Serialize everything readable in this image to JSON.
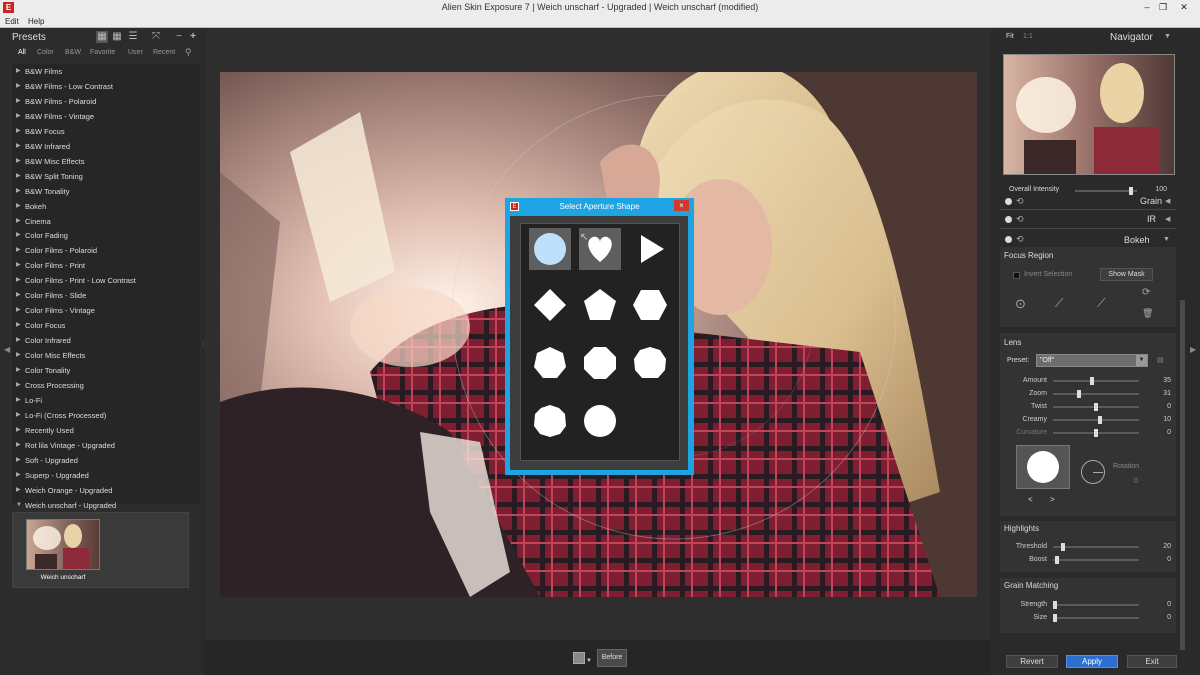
{
  "window": {
    "title": "Alien Skin Exposure 7 | Weich unscharf - Upgraded | Weich unscharf (modified)",
    "logo": "E"
  },
  "menu": [
    "Edit",
    "Help"
  ],
  "presets": {
    "title": "Presets",
    "filters": [
      "All",
      "Color",
      "B&W",
      "Favorite",
      "User",
      "Recent"
    ],
    "items": [
      "B&W Films",
      "B&W Films - Low Contrast",
      "B&W Films - Polaroid",
      "B&W Films - Vintage",
      "B&W Focus",
      "B&W Infrared",
      "B&W Misc Effects",
      "B&W Split Toning",
      "B&W Tonality",
      "Bokeh",
      "Cinema",
      "Color Fading",
      "Color Films - Polaroid",
      "Color Films - Print",
      "Color Films - Print - Low Contrast",
      "Color Films - Slide",
      "Color Films - Vintage",
      "Color Focus",
      "Color Infrared",
      "Color Misc Effects",
      "Color Tonality",
      "Cross Processing",
      "Lo-Fi",
      "Lo-Fi (Cross Processed)",
      "Recently Used",
      "Rot lila Vintage - Upgraded",
      "Soft - Upgraded",
      "Superp - Upgraded",
      "Weich Orange - Upgraded",
      "Weich unscharf - Upgraded"
    ],
    "thumb_label": "Weich unscharf"
  },
  "bottom": {
    "before_label": "Before"
  },
  "dialog": {
    "title": "Select Aperture Shape",
    "logo": "E",
    "close": "×"
  },
  "navigator": {
    "fit": "Fit",
    "one_to_one": "1:1",
    "title": "Navigator"
  },
  "intensity": {
    "label": "Overall Intensity",
    "value": "100",
    "fraction": 1.0
  },
  "panels": {
    "grain": "Grain",
    "ir": "IR",
    "bokeh": "Bokeh"
  },
  "focus_region": {
    "title": "Focus Region",
    "invert": "Invert Selection",
    "show_mask": "Show Mask"
  },
  "lens": {
    "title": "Lens",
    "preset_label": "Preset:",
    "preset_value": "\"Off\"",
    "sliders": [
      {
        "label": "Amount",
        "value": "35"
      },
      {
        "label": "Zoom",
        "value": "31"
      },
      {
        "label": "Twist",
        "value": "0"
      },
      {
        "label": "Creamy",
        "value": "10"
      },
      {
        "label": "Curvature",
        "value": "0"
      }
    ],
    "rotation_label": "Rotation",
    "rotation_value": "0",
    "prev": "<",
    "next": ">"
  },
  "highlights": {
    "title": "Highlights",
    "sliders": [
      {
        "label": "Threshold",
        "value": "20"
      },
      {
        "label": "Boost",
        "value": "0"
      }
    ]
  },
  "grain_matching": {
    "title": "Grain Matching",
    "sliders": [
      {
        "label": "Strength",
        "value": "0"
      },
      {
        "label": "Size",
        "value": "0"
      }
    ]
  },
  "actions": {
    "revert": "Revert",
    "apply": "Apply",
    "exit": "Exit"
  },
  "colors": {
    "accent": "#1ea3e3",
    "apply": "#2d6fd0",
    "logo": "#c8261e"
  }
}
